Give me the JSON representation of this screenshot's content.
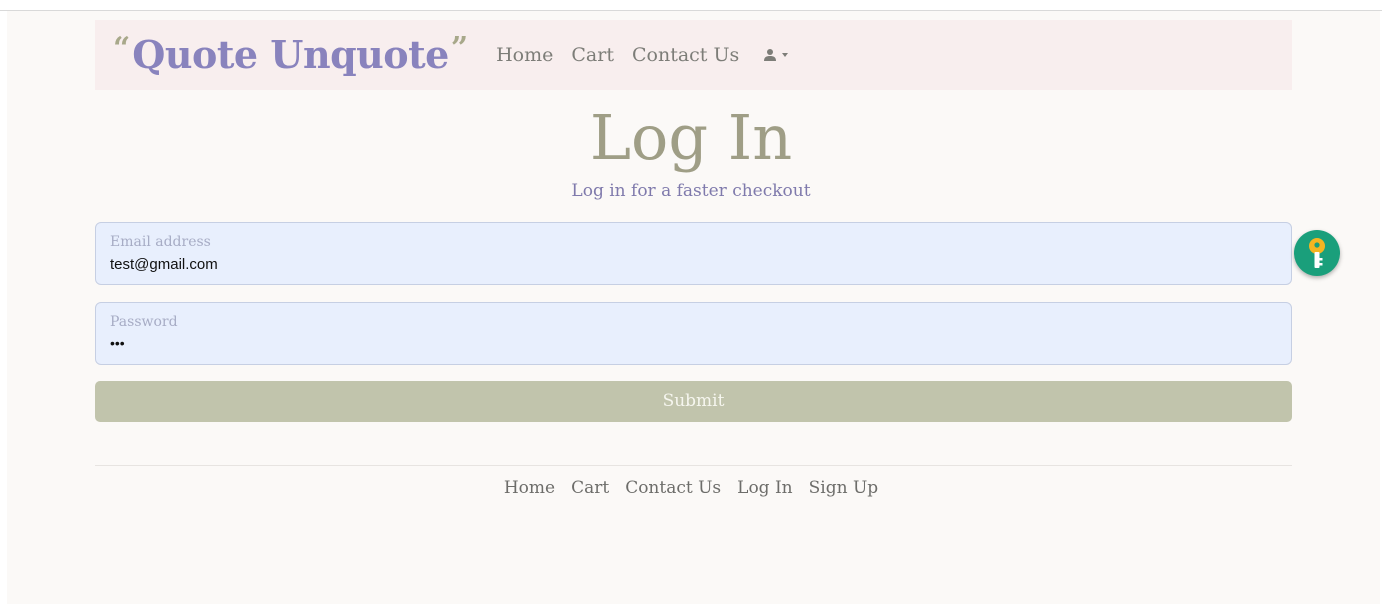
{
  "brand": {
    "open_quote": "“",
    "name": "Quote Unquote",
    "close_quote": "”",
    "color": "#8983bd"
  },
  "nav": {
    "links": [
      "Home",
      "Cart",
      "Contact Us"
    ],
    "user_icon": "user-icon",
    "dropdown_icon": "caret-down-icon"
  },
  "main": {
    "title": "Log In",
    "subtitle": "Log in for a faster checkout"
  },
  "form": {
    "email": {
      "label": "Email address",
      "value": "test@gmail.com"
    },
    "password": {
      "label": "Password",
      "value": "•••"
    },
    "submit_label": "Submit"
  },
  "footer": {
    "links": [
      "Home",
      "Cart",
      "Contact Us",
      "Log In",
      "Sign Up"
    ]
  },
  "extension": {
    "icon": "key-icon",
    "color": "#1a9f7b"
  }
}
